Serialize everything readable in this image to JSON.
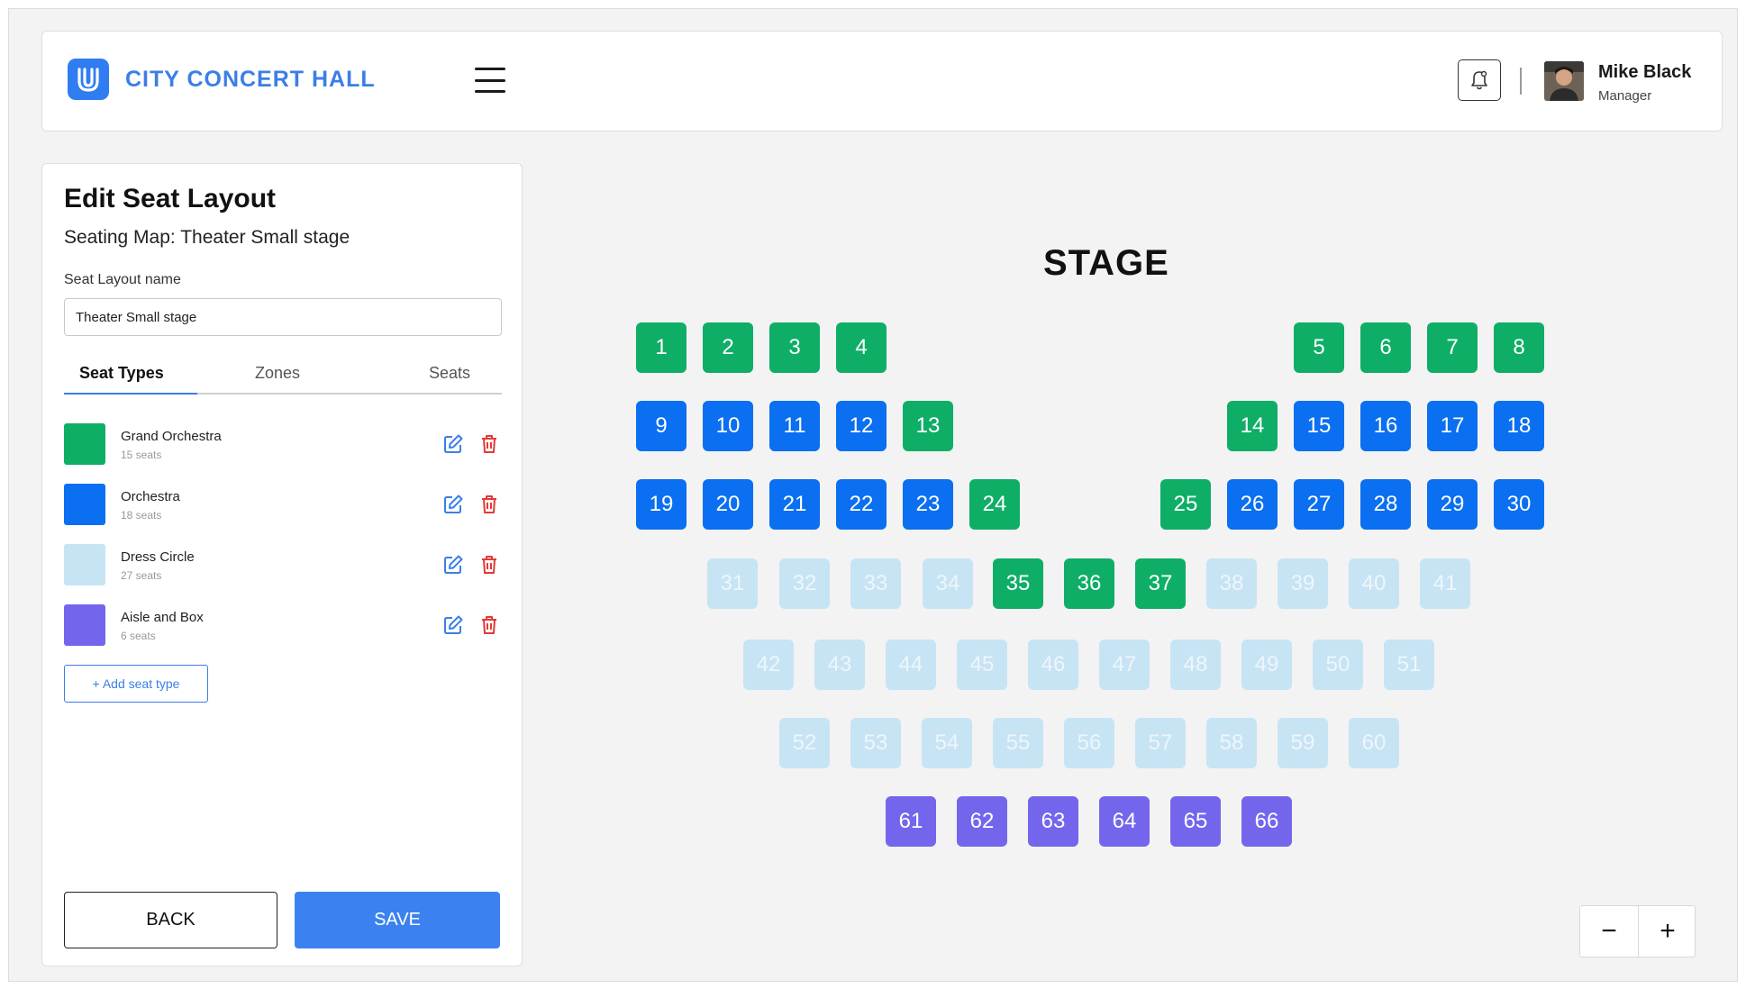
{
  "header": {
    "brand": "CITY CONCERT HALL",
    "menu_icon": "hamburger-menu-icon",
    "notification_icon": "bell-icon",
    "user": {
      "name": "Mike Black",
      "role": "Manager"
    }
  },
  "panel": {
    "title": "Edit Seat Layout",
    "subtitle": "Seating Map: Theater Small stage",
    "field_label": "Seat Layout name",
    "field_value": "Theater Small stage",
    "tabs": [
      {
        "label": "Seat Types",
        "active": true
      },
      {
        "label": "Zones",
        "active": false
      },
      {
        "label": "Seats",
        "active": false
      }
    ],
    "seat_types": [
      {
        "name": "Grand Orchestra",
        "count": "15 seats",
        "color": "#0fae67",
        "key": "grand"
      },
      {
        "name": "Orchestra",
        "count": "18 seats",
        "color": "#0a6ff0",
        "key": "orch"
      },
      {
        "name": "Dress Circle",
        "count": "27 seats",
        "color": "#c7e4f4",
        "key": "dress"
      },
      {
        "name": "Aisle and Box",
        "count": "6 seats",
        "color": "#7466ec",
        "key": "box"
      }
    ],
    "add_label": "+ Add seat type",
    "back_label": "BACK",
    "save_label": "SAVE"
  },
  "stage": {
    "label": "STAGE",
    "rows": [
      [
        [
          "1",
          "grand"
        ],
        [
          "2",
          "grand"
        ],
        [
          "3",
          "grand"
        ],
        [
          "4",
          "grand"
        ],
        [
          "5",
          "grand"
        ],
        [
          "6",
          "grand"
        ],
        [
          "7",
          "grand"
        ],
        [
          "8",
          "grand"
        ]
      ],
      [
        [
          "9",
          "orch"
        ],
        [
          "10",
          "orch"
        ],
        [
          "11",
          "orch"
        ],
        [
          "12",
          "orch"
        ],
        [
          "13",
          "grand"
        ],
        [
          "14",
          "grand"
        ],
        [
          "15",
          "orch"
        ],
        [
          "16",
          "orch"
        ],
        [
          "17",
          "orch"
        ],
        [
          "18",
          "orch"
        ]
      ],
      [
        [
          "19",
          "orch"
        ],
        [
          "20",
          "orch"
        ],
        [
          "21",
          "orch"
        ],
        [
          "22",
          "orch"
        ],
        [
          "23",
          "orch"
        ],
        [
          "24",
          "grand"
        ],
        [
          "25",
          "grand"
        ],
        [
          "26",
          "orch"
        ],
        [
          "27",
          "orch"
        ],
        [
          "28",
          "orch"
        ],
        [
          "29",
          "orch"
        ],
        [
          "30",
          "orch"
        ]
      ],
      [
        [
          "31",
          "dress"
        ],
        [
          "32",
          "dress"
        ],
        [
          "33",
          "dress"
        ],
        [
          "34",
          "dress"
        ],
        [
          "35",
          "grand"
        ],
        [
          "36",
          "grand"
        ],
        [
          "37",
          "grand"
        ],
        [
          "38",
          "dress"
        ],
        [
          "39",
          "dress"
        ],
        [
          "40",
          "dress"
        ],
        [
          "41",
          "dress"
        ]
      ],
      [
        [
          "42",
          "dress"
        ],
        [
          "43",
          "dress"
        ],
        [
          "44",
          "dress"
        ],
        [
          "45",
          "dress"
        ],
        [
          "46",
          "dress"
        ],
        [
          "47",
          "dress"
        ],
        [
          "48",
          "dress"
        ],
        [
          "49",
          "dress"
        ],
        [
          "50",
          "dress"
        ],
        [
          "51",
          "dress"
        ]
      ],
      [
        [
          "52",
          "dress"
        ],
        [
          "53",
          "dress"
        ],
        [
          "54",
          "dress"
        ],
        [
          "55",
          "dress"
        ],
        [
          "56",
          "dress"
        ],
        [
          "57",
          "dress"
        ],
        [
          "58",
          "dress"
        ],
        [
          "59",
          "dress"
        ],
        [
          "60",
          "dress"
        ]
      ],
      [
        [
          "61",
          "box"
        ],
        [
          "62",
          "box"
        ],
        [
          "63",
          "box"
        ],
        [
          "64",
          "box"
        ],
        [
          "65",
          "box"
        ],
        [
          "66",
          "box"
        ]
      ]
    ]
  },
  "zoom": {
    "minus": "−",
    "plus": "+"
  }
}
